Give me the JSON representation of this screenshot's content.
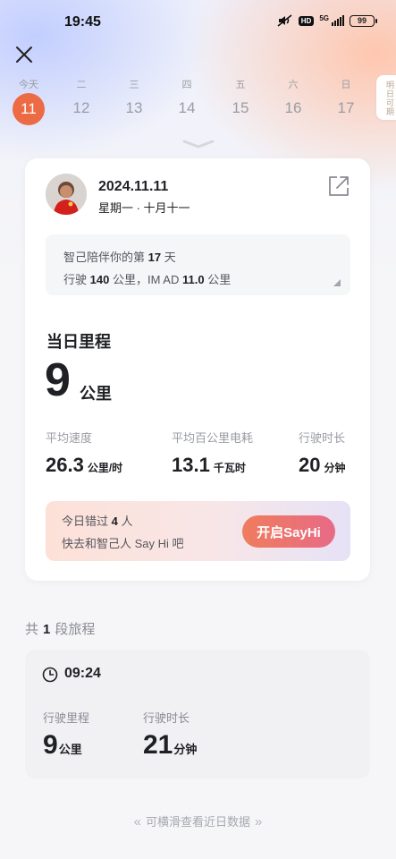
{
  "status_bar": {
    "time": "19:45",
    "hd": "HD",
    "network": "5G",
    "battery": "99"
  },
  "week": {
    "days": [
      {
        "weekday": "今天",
        "date": "11",
        "active": true
      },
      {
        "weekday": "二",
        "date": "12"
      },
      {
        "weekday": "三",
        "date": "13"
      },
      {
        "weekday": "四",
        "date": "14"
      },
      {
        "weekday": "五",
        "date": "15"
      },
      {
        "weekday": "六",
        "date": "16"
      },
      {
        "weekday": "日",
        "date": "17"
      }
    ],
    "tomorrow_tag": "明日可期"
  },
  "card": {
    "date": "2024.11.11",
    "date_sub": "星期一 · 十月十一",
    "note": {
      "line1_prefix": "智己陪伴你的第",
      "days": "17",
      "line1_suffix": "天",
      "line2_prefix": "行驶",
      "drive_km": "140",
      "line2_mid": "公里，IM AD",
      "imad_km": "11.0",
      "line2_suffix": "公里"
    },
    "mileage": {
      "label": "当日里程",
      "value": "9",
      "unit": "公里"
    },
    "stats": [
      {
        "label": "平均速度",
        "value": "26.3",
        "unit": "公里/时"
      },
      {
        "label": "平均百公里电耗",
        "value": "13.1",
        "unit": "千瓦时"
      },
      {
        "label": "行驶时长",
        "value": "20",
        "unit": "分钟"
      }
    ],
    "sayhi": {
      "line1_prefix": "今日错过",
      "count": "4",
      "line1_suffix": "人",
      "line2": "快去和智己人 Say Hi 吧",
      "button": "开启SayHi"
    }
  },
  "trips": {
    "heading_prefix": "共",
    "count": "1",
    "heading_suffix": "段旅程",
    "items": [
      {
        "time": "09:24",
        "distance_label": "行驶里程",
        "distance": "9",
        "distance_unit": "公里",
        "duration_label": "行驶时长",
        "duration": "21",
        "duration_unit": "分钟"
      }
    ]
  },
  "footer_hint": "可横滑查看近日数据",
  "colors": {
    "accent": "#ec6b44",
    "button_start": "#ef7d5d",
    "button_end": "#e86a86"
  }
}
